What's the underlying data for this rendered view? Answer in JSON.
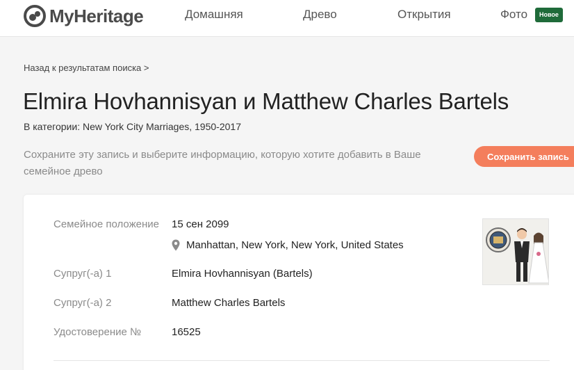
{
  "header": {
    "logo_text": "MyHeritage",
    "nav": [
      {
        "label": "Домашняя"
      },
      {
        "label": "Древо"
      },
      {
        "label": "Открытия"
      },
      {
        "label": "Фото"
      }
    ],
    "badge": "Новое"
  },
  "breadcrumb": "Назад к результатам поиска >",
  "record": {
    "title": "Elmira Hovhannisyan и Matthew Charles Bartels",
    "category": "В категории: New York City Marriages, 1950-2017",
    "save_text": "Сохраните эту запись и выберите информацию, которую хотите добавить в Ваше семейное древо",
    "save_button": "Сохранить запись",
    "fields": {
      "marital_label": "Семейное положение",
      "marital_date": "15 сен 2099",
      "marital_place": "Manhattan, New York, New York, United States",
      "spouse1_label": "Супруг(-а) 1",
      "spouse1_value": "Elmira Hovhannisyan (Bartels)",
      "spouse2_label": "Супруг(-а) 2",
      "spouse2_value": "Matthew Charles Bartels",
      "certificate_label": "Удостоверение №",
      "certificate_value": "16525"
    }
  },
  "colors": {
    "accent": "#f47e5c",
    "badge": "#1f6b3a",
    "background": "#f5f5f5"
  },
  "icons": [
    "myheritage-logo-icon",
    "map-pin-icon",
    "marriage-record-thumbnail"
  ]
}
